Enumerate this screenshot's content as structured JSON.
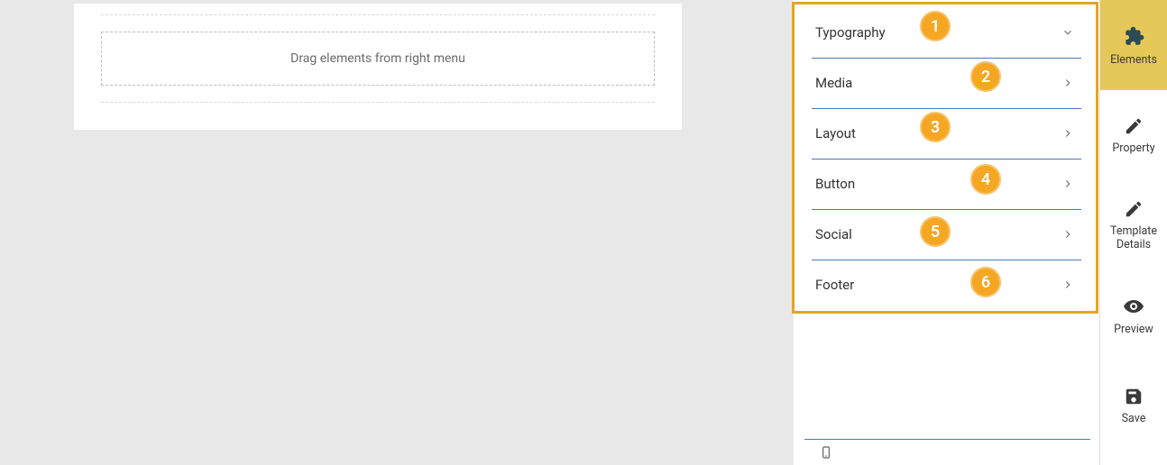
{
  "canvas": {
    "dropzone_text": "Drag elements from right menu"
  },
  "panel": {
    "items": [
      {
        "label": "Typography",
        "expanded": true,
        "badge": "1"
      },
      {
        "label": "Media",
        "expanded": false,
        "badge": "2"
      },
      {
        "label": "Layout",
        "expanded": false,
        "badge": "3"
      },
      {
        "label": "Button",
        "expanded": false,
        "badge": "4"
      },
      {
        "label": "Social",
        "expanded": false,
        "badge": "5"
      },
      {
        "label": "Footer",
        "expanded": false,
        "badge": "6"
      }
    ]
  },
  "toolbar": {
    "elements": "Elements",
    "property": "Property",
    "template_details": "Template\nDetails",
    "preview": "Preview",
    "save": "Save"
  }
}
